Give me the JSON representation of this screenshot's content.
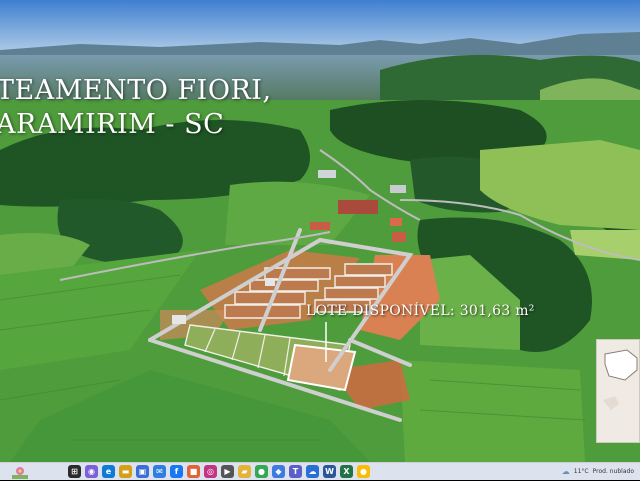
{
  "overlay": {
    "title_line1": "TEAMENTO FIORI,",
    "title_line2": "ARAMIRIM - SC",
    "lot_label": "LOTE DISPONÍVEL: 301,63 m²"
  },
  "taskbar": {
    "weather_temp": "11°C",
    "weather_desc": "Prod. nublado",
    "apps": [
      "search-icon",
      "task-view-icon",
      "edge-icon",
      "file-explorer-icon",
      "store-icon",
      "mail-icon",
      "facebook-icon",
      "office-icon",
      "instagram-icon",
      "media-icon",
      "folder-icon",
      "chrome-icon",
      "app-icon",
      "teams-icon",
      "onedrive-icon",
      "word-icon",
      "excel-icon",
      "chrome-profile-icon"
    ]
  },
  "colors": {
    "sky": "#4f8fd8",
    "grass": "#4f9c3c",
    "forest": "#1f5524",
    "soil": "#d4774a",
    "taskbar": "#dde3ee"
  }
}
